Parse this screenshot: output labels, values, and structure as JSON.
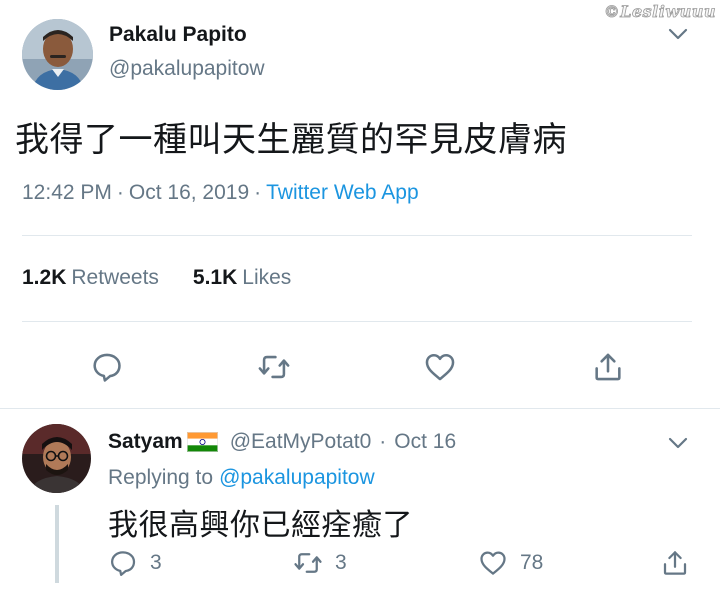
{
  "watermark": "©Lesliwuuu",
  "main_tweet": {
    "author_name": "Pakalu Papito",
    "author_handle": "@pakalupapitow",
    "text": "我得了一種叫天生麗質的罕見皮膚病",
    "time": "12:42 PM",
    "date": "Oct 16, 2019",
    "separator": "·",
    "source": "Twitter Web App",
    "retweets_count": "1.2K",
    "retweets_label": "Retweets",
    "likes_count": "5.1K",
    "likes_label": "Likes"
  },
  "reply_tweet": {
    "author_name": "Satyam",
    "author_handle": "@EatMyPotat0",
    "separator": "·",
    "date": "Oct 16",
    "replying_to_label": "Replying to",
    "replying_to_handle": "@pakalupapitow",
    "text": "我很高興你已經痊癒了",
    "reply_count": "3",
    "retweet_count": "3",
    "like_count": "78"
  },
  "icons": {
    "reply": "reply-icon",
    "retweet": "retweet-icon",
    "like": "heart-icon",
    "share": "share-icon",
    "more": "chevron-down-icon",
    "flag": "india-flag-icon"
  },
  "colors": {
    "primary_text": "#14171a",
    "secondary_text": "#657786",
    "link": "#1b95e0",
    "divider": "#e1e8ed"
  }
}
